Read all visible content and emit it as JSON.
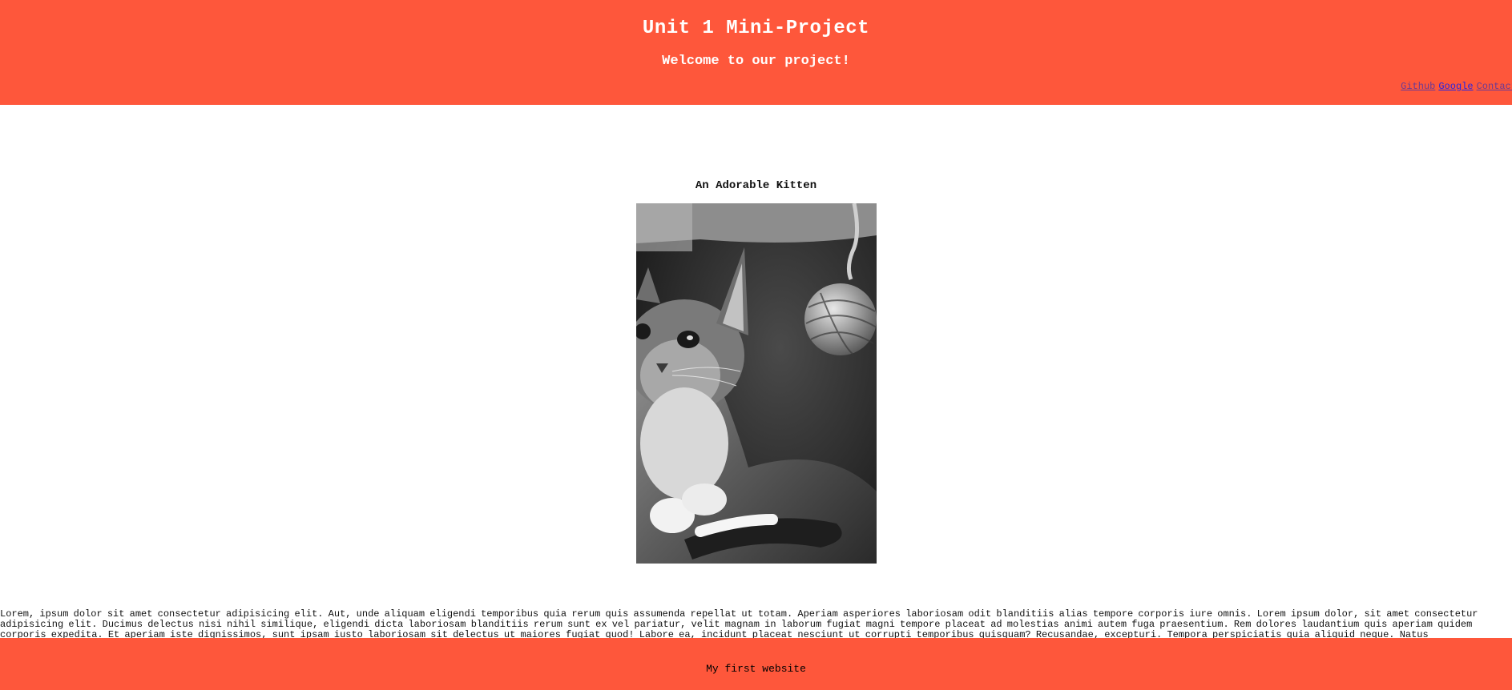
{
  "header": {
    "title": "Unit 1 Mini-Project",
    "subtitle": "Welcome to our project!",
    "nav": {
      "github": "Github",
      "google": "Google",
      "contact": "Contact"
    }
  },
  "main": {
    "caption": "An Adorable Kitten",
    "image_subject": "kitten-photo",
    "paragraph": "Lorem, ipsum dolor sit amet consectetur adipisicing elit. Aut, unde aliquam eligendi temporibus quia rerum quis assumenda repellat ut totam. Aperiam asperiores laboriosam odit blanditiis alias tempore corporis iure omnis. Lorem ipsum dolor, sit amet consectetur adipisicing elit. Ducimus delectus nisi nihil similique, eligendi dicta laboriosam blanditiis rerum sunt ex vel pariatur, velit magnam in laborum fugiat magni tempore placeat ad molestias animi autem fuga praesentium. Rem dolores laudantium quis aperiam quidem corporis expedita. Et aperiam iste dignissimos, sunt ipsam iusto laboriosam sit delectus ut maiores fugiat quod! Labore ea, incidunt placeat nesciunt ut corrupti temporibus quisquam? Recusandae, excepturi. Tempora perspiciatis quia aliquid neque. Natus"
  },
  "footer": {
    "text": "My first website"
  },
  "colors": {
    "header_bg": "#fe573b",
    "footer_bg": "#fe573b",
    "link": "#2424e6",
    "visited_link": "#6a3a96"
  }
}
